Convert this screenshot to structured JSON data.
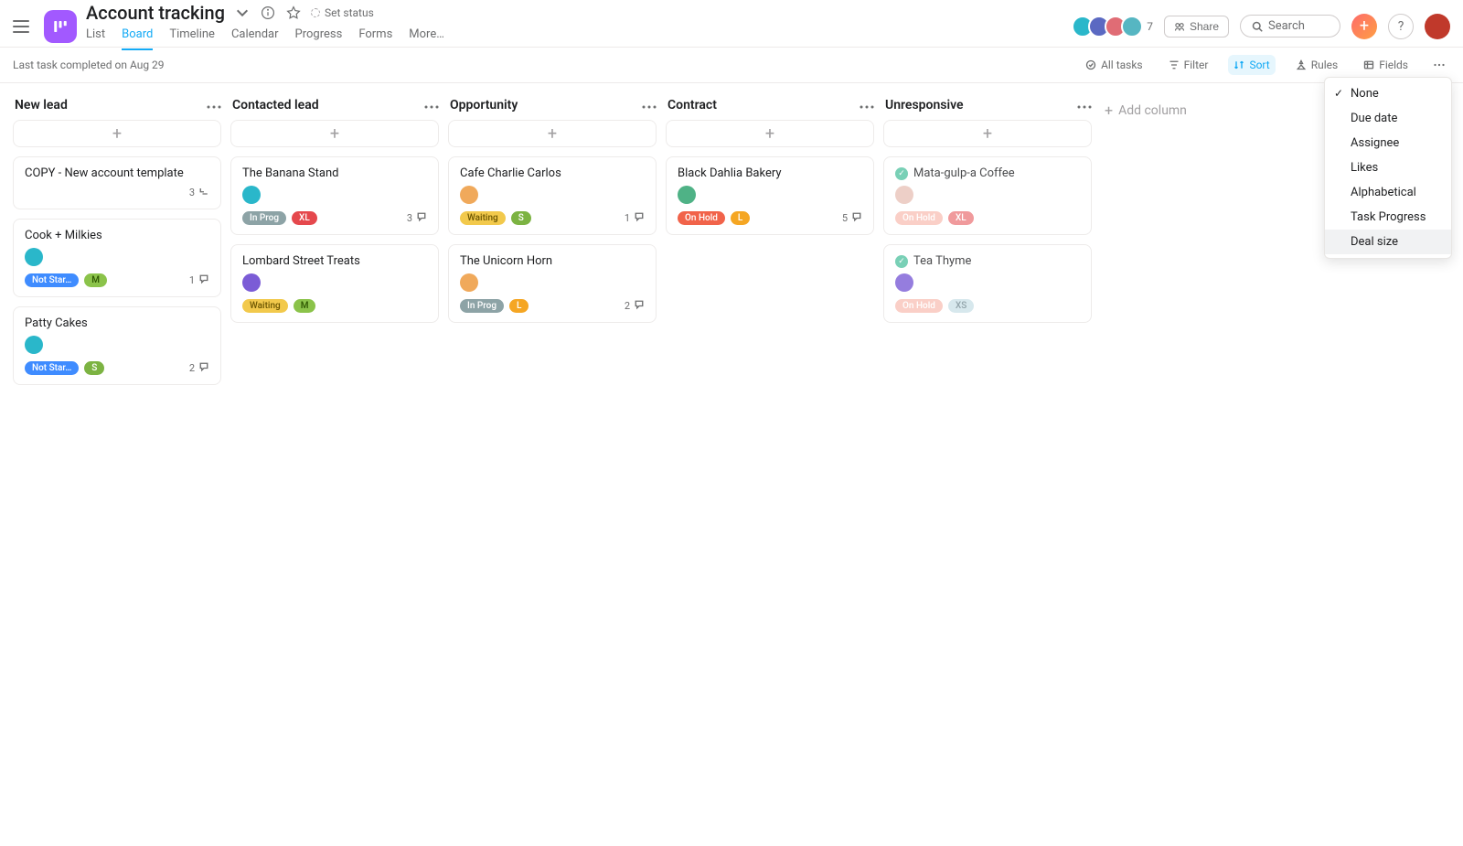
{
  "header": {
    "project_title": "Account tracking",
    "set_status": "Set status",
    "tabs": [
      "List",
      "Board",
      "Timeline",
      "Calendar",
      "Progress",
      "Forms",
      "More…"
    ],
    "active_tab": 1,
    "share_label": "Share",
    "search_placeholder": "Search",
    "avatar_overflow": "7"
  },
  "subbar": {
    "status_text": "Last task completed on Aug 29",
    "items": {
      "all_tasks": "All tasks",
      "filter": "Filter",
      "sort": "Sort",
      "rules": "Rules",
      "fields": "Fields"
    }
  },
  "sort_menu": {
    "options": [
      "None",
      "Due date",
      "Assignee",
      "Likes",
      "Alphabetical",
      "Task Progress",
      "Deal size"
    ],
    "checked": 0,
    "hovered": 6
  },
  "board": {
    "add_column_label": "Add column",
    "columns": [
      {
        "title": "New lead",
        "cards": [
          {
            "title": "COPY - New account template",
            "subtasks": "3",
            "subtasks_icon": true
          },
          {
            "title": "Cook + Milkies",
            "assignee_color": "avc1",
            "pills": [
              [
                "Not Star…",
                "p-notstart"
              ],
              [
                "M",
                "p-m"
              ]
            ],
            "comments": "1"
          },
          {
            "title": "Patty Cakes",
            "assignee_color": "avc1",
            "pills": [
              [
                "Not Star…",
                "p-notstart"
              ],
              [
                "S",
                "p-s"
              ]
            ],
            "comments": "2"
          }
        ]
      },
      {
        "title": "Contacted lead",
        "cards": [
          {
            "title": "The Banana Stand",
            "assignee_color": "avc1",
            "pills": [
              [
                "In Prog",
                "p-inprog"
              ],
              [
                "XL",
                "p-xl"
              ]
            ],
            "comments": "3"
          },
          {
            "title": "Lombard Street Treats",
            "assignee_color": "avc2",
            "pills": [
              [
                "Waiting",
                "p-wait"
              ],
              [
                "M",
                "p-m"
              ]
            ]
          }
        ]
      },
      {
        "title": "Opportunity",
        "cards": [
          {
            "title": "Cafe Charlie Carlos",
            "assignee_color": "avc3",
            "pills": [
              [
                "Waiting",
                "p-wait"
              ],
              [
                "S",
                "p-s"
              ]
            ],
            "comments": "1"
          },
          {
            "title": "The Unicorn Horn",
            "assignee_color": "avc3",
            "pills": [
              [
                "In Prog",
                "p-inprog"
              ],
              [
                "L",
                "p-l"
              ]
            ],
            "comments": "2"
          }
        ]
      },
      {
        "title": "Contract",
        "cards": [
          {
            "title": "Black Dahlia Bakery",
            "assignee_color": "avc4",
            "pills": [
              [
                "On Hold",
                "p-onhold"
              ],
              [
                "L",
                "p-l"
              ]
            ],
            "comments": "5"
          }
        ]
      },
      {
        "title": "Unresponsive",
        "muted": true,
        "cards": [
          {
            "title": "Mata-gulp-a Coffee",
            "done": true,
            "assignee_color": "avc5",
            "pills": [
              [
                "On Hold",
                "p-onhold-m"
              ],
              [
                "XL",
                "p-xl"
              ]
            ]
          },
          {
            "title": "Tea Thyme",
            "done": true,
            "assignee_color": "avc2",
            "pills": [
              [
                "On Hold",
                "p-onhold-m"
              ],
              [
                "XS",
                "p-xs"
              ]
            ]
          }
        ]
      }
    ]
  }
}
